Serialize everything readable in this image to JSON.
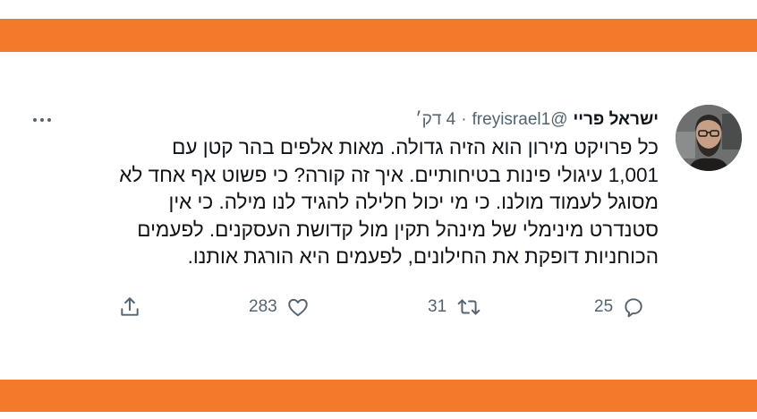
{
  "tweet": {
    "author_name": "ישראל פריי",
    "handle": "@freyisrael1",
    "separator": "·",
    "time": "4 דק׳",
    "text": "כל פרויקט מירון הוא הזיה גדולה. מאות אלפים בהר קטן עם\n1,001 עיגולי פינות בטיחותיים. איך זה קורה? כי פשוט אף אחד לא\nמסוגל לעמוד מולנו. כי מי יכול חלילה להגיד לנו מילה. כי אין\nסטנדרט מינימלי של מינהל תקין מול קדושת העסקנים. לפעמים\nהכוחניות דופקת את החילונים, לפעמים היא הורגת אותנו.",
    "reply_count": "25",
    "retweet_count": "31",
    "like_count": "283"
  },
  "colors": {
    "accent_band": "#f47a2b",
    "text_primary": "#0f1419",
    "text_secondary": "#536471"
  },
  "icons": {
    "more": "more-horizontal-icon",
    "reply": "reply-icon",
    "retweet": "retweet-icon",
    "like": "like-icon",
    "share": "share-icon"
  }
}
